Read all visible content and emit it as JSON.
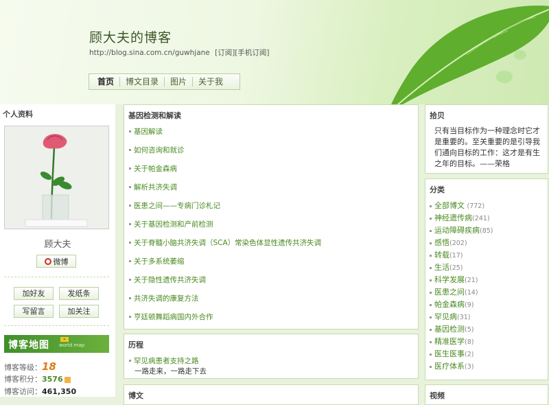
{
  "header": {
    "title": "顾大夫的博客",
    "url": "http://blog.sina.com.cn/guwhjane",
    "subscribe": "[订阅]",
    "mobile_subscribe": "[手机订阅]"
  },
  "nav": [
    "首页",
    "博文目录",
    "图片",
    "关于我"
  ],
  "profile": {
    "section_title": "个人资料",
    "name": "顾大夫",
    "weibo": "微博",
    "buttons": [
      "加好友",
      "发纸条",
      "写留言",
      "加关注"
    ],
    "map_title": "博客地图",
    "map_sub": "world map",
    "level_label": "博客等级：",
    "level": "18",
    "score_label": "博客积分：",
    "score": "3576",
    "visits_label": "博客访问：",
    "visits": "461,350"
  },
  "main": {
    "section1_title": "基因检测和解读",
    "section1_links": [
      "基因解读",
      "如何咨询和就诊",
      "关于帕金森病",
      "解析共济失调",
      "医患之间——专病门诊札记",
      "关于基因检测和产前检测",
      "关于脊髓小脑共济失调（SCA）常染色体显性遗传共济失调",
      "关于多系统萎缩",
      "关于隐性遗传共济失调",
      "共济失调的康复方法",
      "亨廷顿舞蹈病国内外合作"
    ],
    "section2_title": "历程",
    "section2_link": "罕见病患者支持之路",
    "section2_desc": "一路走来，一路走下去",
    "section3_title": "博文"
  },
  "right": {
    "quote_title": "拾贝",
    "quote": "只有当目标作为一种理念时它才是重要的。至关重要的是引导我们通向目标的工作：这才是有生之年的目标。——荣格",
    "category_title": "分类",
    "categories": [
      {
        "name": "全部博文",
        "count": "(772)"
      },
      {
        "name": "神经遗传病",
        "count": "(241)"
      },
      {
        "name": "运动障碍疾病",
        "count": "(85)"
      },
      {
        "name": "感悟",
        "count": "(202)"
      },
      {
        "name": "转载",
        "count": "(17)"
      },
      {
        "name": "生活",
        "count": "(25)"
      },
      {
        "name": "科学发展",
        "count": "(21)"
      },
      {
        "name": "医患之间",
        "count": "(14)"
      },
      {
        "name": "帕金森病",
        "count": "(9)"
      },
      {
        "name": "罕见病",
        "count": "(31)"
      },
      {
        "name": "基因检测",
        "count": "(5)"
      },
      {
        "name": "精准医学",
        "count": "(8)"
      },
      {
        "name": "医生医事",
        "count": "(2)"
      },
      {
        "name": "医疗体系",
        "count": "(3)"
      }
    ],
    "video_title": "视频"
  }
}
